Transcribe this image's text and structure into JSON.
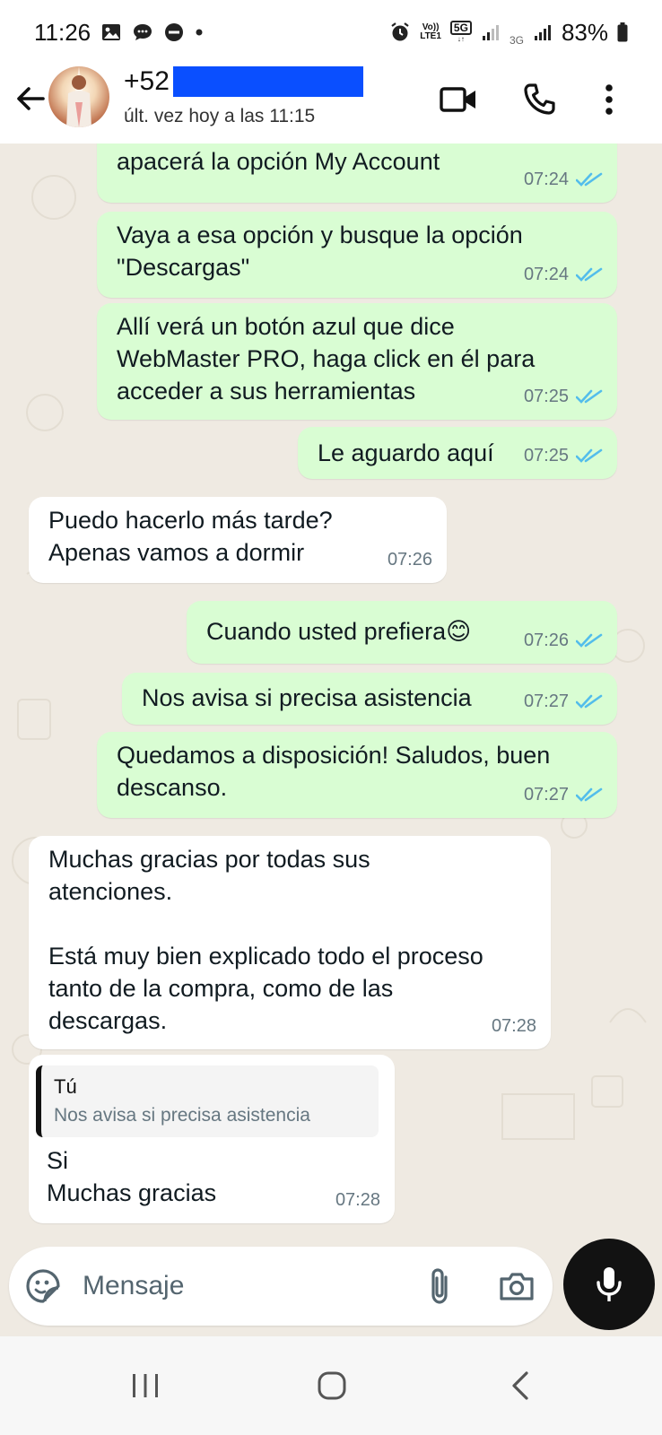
{
  "status_bar": {
    "time": "11:26",
    "network_top": "Vo))",
    "network_bottom": "LTE1",
    "badge_5g": "5G",
    "label_3g": "3G",
    "battery": "83%",
    "icons": [
      "gallery-icon",
      "chat-bubble-icon",
      "do-not-disturb-icon",
      "dot-icon",
      "alarm-icon",
      "signal-icon",
      "battery-icon"
    ]
  },
  "header": {
    "contact_name": "+52",
    "last_seen": "últ. vez hoy a las 11:15",
    "icons": [
      "back-arrow-icon",
      "video-call-icon",
      "phone-icon",
      "more-vert-icon"
    ]
  },
  "messages": [
    {
      "direction": "out",
      "text": "Una vez que inicie sesión en el menú\napacerá la opción My Account",
      "time": "07:24",
      "read": true
    },
    {
      "direction": "out",
      "text": "Vaya a esa opción y busque la opción\n\"Descargas\"",
      "time": "07:24",
      "read": true
    },
    {
      "direction": "out",
      "text": "Allí verá un botón azul que dice\nWebMaster PRO, haga click en él para\nacceder a sus herramientas",
      "time": "07:25",
      "read": true
    },
    {
      "direction": "out",
      "text": "Le aguardo aquí",
      "time": "07:25",
      "read": true
    },
    {
      "direction": "in",
      "text": "Puedo hacerlo más tarde?\nApenas vamos a dormir",
      "time": "07:26"
    },
    {
      "direction": "out",
      "text": "Cuando usted prefiera😊",
      "time": "07:26",
      "read": true
    },
    {
      "direction": "out",
      "text": "Nos avisa si precisa asistencia",
      "time": "07:27",
      "read": true
    },
    {
      "direction": "out",
      "text": "Quedamos a disposición! Saludos, buen\ndescanso.",
      "time": "07:27",
      "read": true
    },
    {
      "direction": "in",
      "text": "Muchas gracias por todas sus\natenciones.\n\nEstá muy bien explicado todo el proceso\ntanto de la compra, como de las\ndescargas.",
      "time": "07:28"
    },
    {
      "direction": "in",
      "text": "Si\nMuchas gracias",
      "time": "07:28",
      "quote": {
        "author": "Tú",
        "text": "Nos avisa si precisa asistencia"
      }
    }
  ],
  "composer": {
    "placeholder": "Mensaje",
    "icons": [
      "sticker-icon",
      "attach-icon",
      "camera-icon",
      "mic-icon"
    ]
  },
  "nav": {
    "icons": [
      "recents-icon",
      "home-icon",
      "back-icon"
    ]
  },
  "colors": {
    "outgoing_bubble": "#d9fdd3",
    "incoming_bubble": "#ffffff",
    "chat_background": "#efeae2",
    "read_ticks": "#53bdeb",
    "redaction": "#0a4fff"
  }
}
